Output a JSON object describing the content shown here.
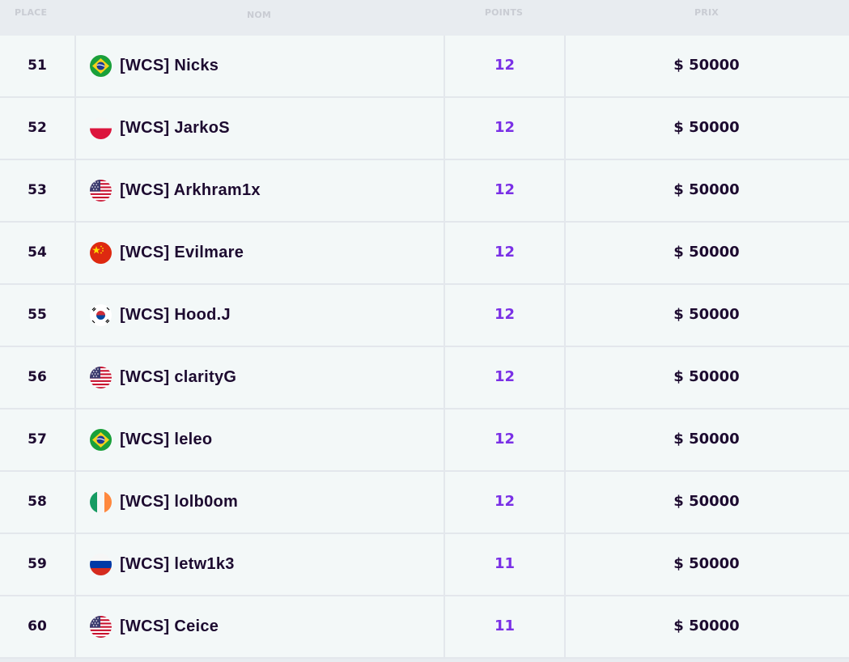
{
  "header": {
    "place": "PLACE",
    "name": "NOM",
    "points": "POINTS",
    "prize": "PRIX"
  },
  "rows": [
    {
      "place": "51",
      "name": "[WCS] Nicks",
      "flag": "brazil-flag-icon",
      "points": "12",
      "prize": "$ 50000"
    },
    {
      "place": "52",
      "name": "[WCS] JarkoS",
      "flag": "poland-flag-icon",
      "points": "12",
      "prize": "$ 50000"
    },
    {
      "place": "53",
      "name": "[WCS] Arkhram1x",
      "flag": "usa-flag-icon",
      "points": "12",
      "prize": "$ 50000"
    },
    {
      "place": "54",
      "name": "[WCS] Evilmare",
      "flag": "china-flag-icon",
      "points": "12",
      "prize": "$ 50000"
    },
    {
      "place": "55",
      "name": "[WCS] Hood.J",
      "flag": "south-korea-flag-icon",
      "points": "12",
      "prize": "$ 50000"
    },
    {
      "place": "56",
      "name": "[WCS] clarityG",
      "flag": "usa-flag-icon",
      "points": "12",
      "prize": "$ 50000"
    },
    {
      "place": "57",
      "name": "[WCS] leleo",
      "flag": "brazil-flag-icon",
      "points": "12",
      "prize": "$ 50000"
    },
    {
      "place": "58",
      "name": "[WCS] lolb0om",
      "flag": "ireland-flag-icon",
      "points": "12",
      "prize": "$ 50000"
    },
    {
      "place": "59",
      "name": "[WCS] letw1k3",
      "flag": "russia-flag-icon",
      "points": "11",
      "prize": "$ 50000"
    },
    {
      "place": "60",
      "name": "[WCS] Ceice",
      "flag": "usa-flag-icon",
      "points": "11",
      "prize": "$ 50000"
    }
  ],
  "colors": {
    "text": "#1d0b30",
    "points": "#7a30e6",
    "row_bg": "#f3f8f8",
    "header_bg": "#e8ecf0"
  }
}
